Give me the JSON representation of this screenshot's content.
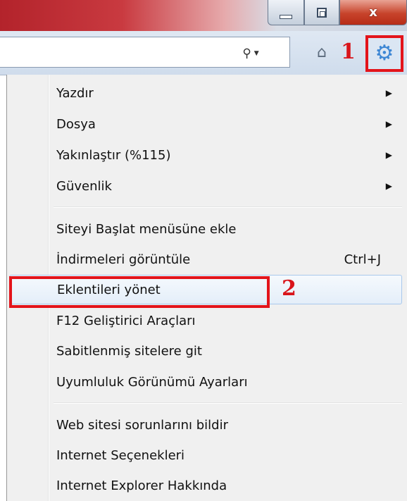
{
  "window_controls": {
    "close_glyph": "x"
  },
  "annotations": {
    "step1": "1",
    "step2": "2",
    "highlight_color": "#e3141b"
  },
  "menu": {
    "groups": [
      [
        {
          "label": "Yazdır",
          "submenu": true
        },
        {
          "label": "Dosya",
          "submenu": true
        },
        {
          "label": "Yakınlaştır (%115)",
          "submenu": true
        },
        {
          "label": "Güvenlik",
          "submenu": true
        }
      ],
      [
        {
          "label": "Siteyi Başlat menüsüne ekle"
        },
        {
          "label": "İndirmeleri görüntüle",
          "shortcut": "Ctrl+J"
        },
        {
          "label": "Eklentileri yönet",
          "highlighted": true
        },
        {
          "label": "F12 Geliştirici Araçları"
        },
        {
          "label": "Sabitlenmiş sitelere git"
        },
        {
          "label": "Uyumluluk Görünümü Ayarları"
        }
      ],
      [
        {
          "label": "Web sitesi sorunlarını bildir"
        },
        {
          "label": "Internet Seçenekleri"
        },
        {
          "label": "Internet Explorer Hakkında"
        }
      ]
    ]
  },
  "icons": {
    "search": "search-icon",
    "home": "home-icon",
    "tools": "gear-icon"
  }
}
